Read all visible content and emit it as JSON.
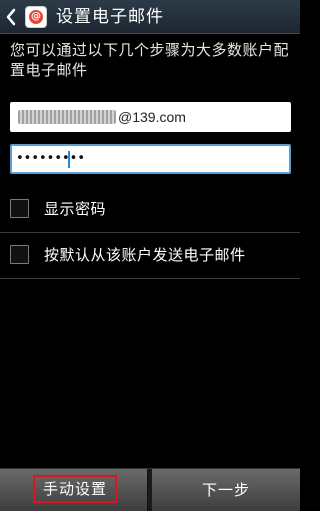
{
  "action_bar": {
    "title": "设置电子邮件",
    "back_icon": "chevron-left-icon",
    "app_icon": "email-app-icon",
    "app_icon_glyph": "@",
    "accent": "#e64635"
  },
  "instruction": "您可以通过以下几个步骤为大多数账户配置电子邮件",
  "email": {
    "value_visible_suffix": "@139.com",
    "masked": true
  },
  "password": {
    "value_display": "•••••••••",
    "focused": true,
    "focus_color": "#5a9fd4"
  },
  "options": [
    {
      "label": "显示密码",
      "checked": false
    },
    {
      "label": "按默认从该账户发送电子邮件",
      "checked": false
    }
  ],
  "bottom_bar": {
    "manual_setup_label": "手动设置",
    "next_label": "下一步",
    "highlight_color": "#e0141e"
  }
}
